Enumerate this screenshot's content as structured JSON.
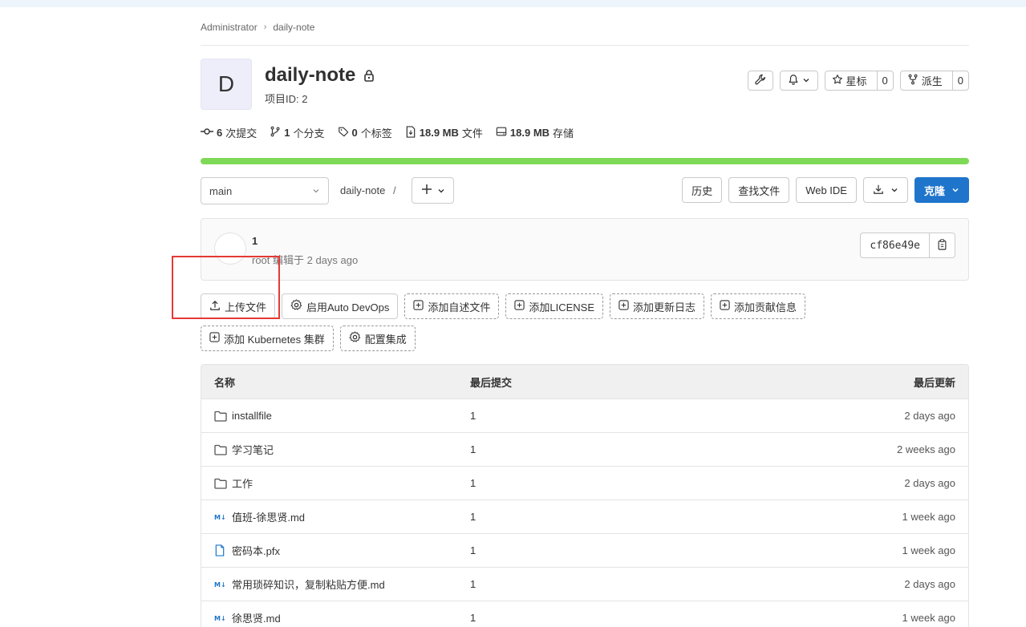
{
  "breadcrumb": {
    "owner": "Administrator",
    "project": "daily-note"
  },
  "project": {
    "avatar_letter": "D",
    "title": "daily-note",
    "id_label": "项目ID: 2"
  },
  "header_actions": {
    "star_label": "星标",
    "star_count": "0",
    "fork_label": "派生",
    "fork_count": "0"
  },
  "stats": {
    "commits_num": "6",
    "commits_label": "次提交",
    "branches_num": "1",
    "branches_label": "个分支",
    "tags_num": "0",
    "tags_label": "个标签",
    "files_num": "18.9 MB",
    "files_label": "文件",
    "storage_num": "18.9 MB",
    "storage_label": "存储"
  },
  "storage_progress_percent": 100,
  "toolbar": {
    "branch": "main",
    "path": "daily-note",
    "path_sep": "/",
    "history": "历史",
    "find_file": "查找文件",
    "web_ide": "Web IDE",
    "clone": "克隆"
  },
  "last_commit": {
    "title": "1",
    "meta": "root 编辑于 2 days ago",
    "sha": "cf86e49e"
  },
  "quick_actions": {
    "upload": "上传文件",
    "auto_devops": "启用Auto DevOps",
    "add_readme": "添加自述文件",
    "add_license": "添加LICENSE",
    "add_changelog": "添加更新日志",
    "add_contrib": "添加贡献信息",
    "add_k8s": "添加 Kubernetes 集群",
    "config_integration": "配置集成"
  },
  "file_table": {
    "headers": {
      "name": "名称",
      "last_commit": "最后提交",
      "last_update": "最后更新"
    },
    "rows": [
      {
        "icon": "folder-icon",
        "name": "installfile",
        "commit": "1",
        "date": "2 days ago"
      },
      {
        "icon": "folder-icon",
        "name": "学习笔记",
        "commit": "1",
        "date": "2 weeks ago"
      },
      {
        "icon": "folder-icon",
        "name": "工作",
        "commit": "1",
        "date": "2 days ago"
      },
      {
        "icon": "markdown-icon",
        "name": "值班-徐思贤.md",
        "commit": "1",
        "date": "1 week ago"
      },
      {
        "icon": "file-icon",
        "name": "密码本.pfx",
        "commit": "1",
        "date": "1 week ago"
      },
      {
        "icon": "markdown-icon",
        "name": "常用琐碎知识，复制粘贴方便.md",
        "commit": "1",
        "date": "2 days ago"
      },
      {
        "icon": "markdown-icon",
        "name": "徐思贤.md",
        "commit": "1",
        "date": "1 week ago"
      }
    ]
  },
  "colors": {
    "primary": "#1f75cb",
    "progress": "#7ed957",
    "highlight": "#e53935"
  }
}
